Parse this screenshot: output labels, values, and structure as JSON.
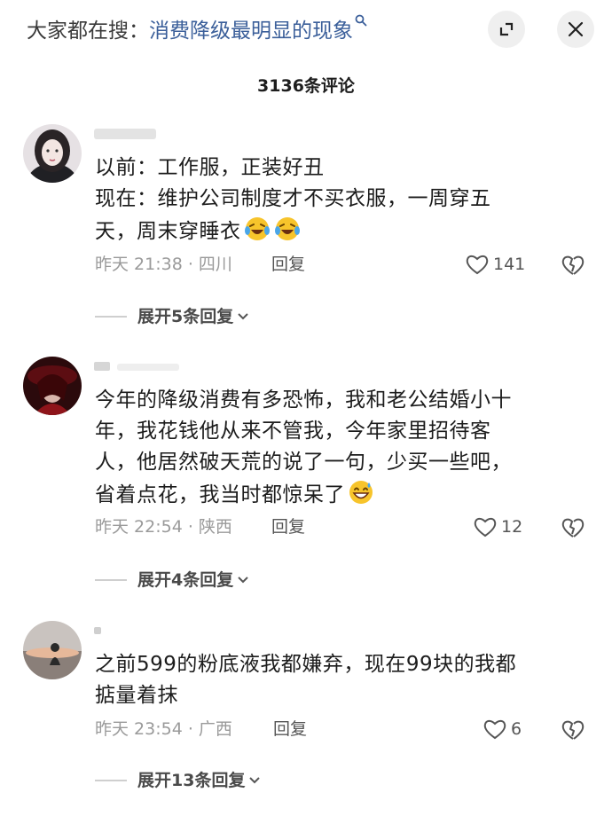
{
  "header": {
    "search_prefix": "大家都在搜：",
    "search_query": "消费降级最明显的现象",
    "comment_count": "3136条评论"
  },
  "comments": [
    {
      "text_lines": [
        "以前：工作服，正装好丑",
        "现在：维护公司制度才不买衣服，一周穿五",
        "天，周末穿睡衣"
      ],
      "time_location": "昨天 21:38 · 四川",
      "reply_label": "回复",
      "likes": "141",
      "expand_label": "展开5条回复"
    },
    {
      "text_lines": [
        "今年的降级消费有多恐怖，我和老公结婚小十",
        "年，我花钱他从来不管我，今年家里招待客",
        "人，他居然破天荒的说了一句，少买一些吧，",
        "省着点花，我当时都惊呆了"
      ],
      "time_location": "昨天 22:54 · 陕西",
      "reply_label": "回复",
      "likes": "12",
      "expand_label": "展开4条回复"
    },
    {
      "text_lines": [
        "之前599的粉底液我都嫌弃，现在99块的我都",
        "掂量着抹"
      ],
      "time_location": "昨天 23:54 · 广西",
      "reply_label": "回复",
      "likes": "6",
      "expand_label": "展开13条回复"
    }
  ],
  "colors": {
    "query_link": "#3b5f9a",
    "meta_gray": "#9a9a9a",
    "button_bg": "#efefef"
  },
  "icons": [
    "search-icon",
    "expand-window-icon",
    "close-icon",
    "heart-icon",
    "broken-heart-icon",
    "chevron-down-icon",
    "laughing-tears-emoji",
    "sweat-smile-emoji"
  ]
}
